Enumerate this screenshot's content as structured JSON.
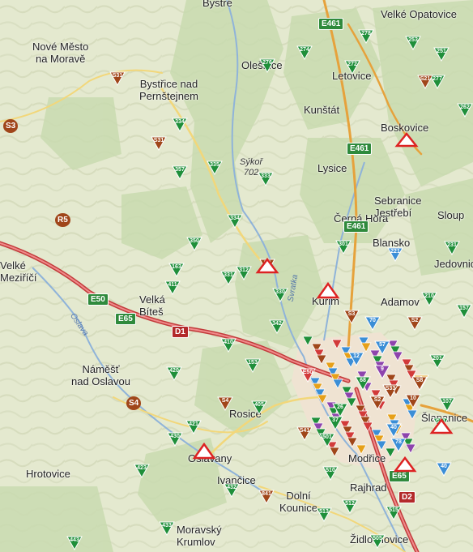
{
  "map": {
    "towns": [
      {
        "name": "Nové Město\nna Moravě",
        "key": "nove-mesto"
      },
      {
        "name": "Bystřice nad\nPernštejnem",
        "key": "bystrice"
      },
      {
        "name": "Olešnice",
        "key": "olesnice"
      },
      {
        "name": "Letovice",
        "key": "letovice"
      },
      {
        "name": "Kunštát",
        "key": "kunstat"
      },
      {
        "name": "Boskovice",
        "key": "boskovice"
      },
      {
        "name": "Velké Opatovice",
        "key": "velke-opatovice"
      },
      {
        "name": "Velké\nMeziříčí",
        "key": "velke-mezirici"
      },
      {
        "name": "Velká\nBíteš",
        "key": "velka-bites"
      },
      {
        "name": "Náměšť\nnad Oslavou",
        "key": "namest"
      },
      {
        "name": "Hrotovice",
        "key": "hrotovice"
      },
      {
        "name": "Rosice",
        "key": "rosice"
      },
      {
        "name": "Oslavany",
        "key": "oslavany"
      },
      {
        "name": "Ivančice",
        "key": "ivancice"
      },
      {
        "name": "Blansko",
        "key": "blansko"
      },
      {
        "name": "Adamov",
        "key": "adamov"
      },
      {
        "name": "Kuřim",
        "key": "kurim"
      },
      {
        "name": "Jedovnice",
        "key": "jedovnice"
      },
      {
        "name": "Sloup",
        "key": "sloup"
      },
      {
        "name": "Lysice",
        "key": "lysice"
      },
      {
        "name": "Černá Hora",
        "key": "cerna-hora"
      },
      {
        "name": "Šlapanice",
        "key": "slapanice"
      },
      {
        "name": "Modřice",
        "key": "modrice"
      },
      {
        "name": "Rajhrad",
        "key": "rajhrad"
      },
      {
        "name": "Dolní\nKounice",
        "key": "dolni-kounice"
      },
      {
        "name": "Moravský\nKrumlov",
        "key": "moravsky-krumlov"
      },
      {
        "name": "Židlochovice",
        "key": "zidlochovice"
      },
      {
        "name": "Bystré",
        "key": "bystre"
      },
      {
        "name": "Sebranice\nJestřebí",
        "key": "jestrebi"
      }
    ],
    "peak": {
      "name": "Sýkoř",
      "elevation": "702"
    },
    "rivers": [
      "Oslava",
      "Svratka"
    ],
    "road_shields": [
      {
        "label": "E50",
        "kind": "e"
      },
      {
        "label": "E65",
        "kind": "e"
      },
      {
        "label": "D1",
        "kind": "d"
      },
      {
        "label": "E461",
        "kind": "e"
      },
      {
        "label": "E461",
        "kind": "e"
      },
      {
        "label": "E461",
        "kind": "e"
      },
      {
        "label": "E65",
        "kind": "e"
      },
      {
        "label": "D2",
        "kind": "d"
      },
      {
        "label": "S3",
        "kind": "s"
      },
      {
        "label": "R5",
        "kind": "s"
      },
      {
        "label": "S4",
        "kind": "s"
      }
    ],
    "markers": [
      {
        "label": "274",
        "color": "green"
      },
      {
        "label": "276",
        "color": "green"
      },
      {
        "label": "272",
        "color": "green"
      },
      {
        "label": "278",
        "color": "green"
      },
      {
        "label": "253",
        "color": "green"
      },
      {
        "label": "251",
        "color": "green"
      },
      {
        "label": "277",
        "color": "green"
      },
      {
        "label": "S21",
        "color": "brown"
      },
      {
        "label": "S31",
        "color": "brown"
      },
      {
        "label": "334",
        "color": "green"
      },
      {
        "label": "335",
        "color": "green"
      },
      {
        "label": "S31",
        "color": "brown"
      },
      {
        "label": "357",
        "color": "green"
      },
      {
        "label": "333",
        "color": "green"
      },
      {
        "label": "334",
        "color": "green"
      },
      {
        "label": "350",
        "color": "green"
      },
      {
        "label": "163",
        "color": "green"
      },
      {
        "label": "411",
        "color": "green"
      },
      {
        "label": "312",
        "color": "green"
      },
      {
        "label": "331",
        "color": "green"
      },
      {
        "label": "S3",
        "color": "brown"
      },
      {
        "label": "330",
        "color": "green"
      },
      {
        "label": "342",
        "color": "green"
      },
      {
        "label": "410",
        "color": "green"
      },
      {
        "label": "153",
        "color": "green"
      },
      {
        "label": "420",
        "color": "green"
      },
      {
        "label": "S4",
        "color": "brown"
      },
      {
        "label": "405",
        "color": "green"
      },
      {
        "label": "421",
        "color": "green"
      },
      {
        "label": "430",
        "color": "green"
      },
      {
        "label": "423",
        "color": "green"
      },
      {
        "label": "S41",
        "color": "brown"
      },
      {
        "label": "501",
        "color": "green"
      },
      {
        "label": "70",
        "color": "blue"
      },
      {
        "label": "57",
        "color": "blue"
      },
      {
        "label": "12",
        "color": "blue"
      },
      {
        "label": "68",
        "color": "green"
      },
      {
        "label": "26",
        "color": "green"
      },
      {
        "label": "37",
        "color": "green"
      },
      {
        "label": "40",
        "color": "blue"
      },
      {
        "label": "E50",
        "color": "red"
      },
      {
        "label": "9",
        "color": "purple"
      },
      {
        "label": "S2",
        "color": "brown"
      },
      {
        "label": "S33",
        "color": "brown"
      },
      {
        "label": "10",
        "color": "brown"
      },
      {
        "label": "8",
        "color": "orange"
      },
      {
        "label": "201",
        "color": "green"
      },
      {
        "label": "210",
        "color": "green"
      },
      {
        "label": "157",
        "color": "green"
      },
      {
        "label": "231",
        "color": "green"
      },
      {
        "label": "S31",
        "color": "green"
      },
      {
        "label": "107",
        "color": "green"
      },
      {
        "label": "40",
        "color": "blue"
      },
      {
        "label": "78",
        "color": "blue"
      },
      {
        "label": "510",
        "color": "green"
      },
      {
        "label": "513",
        "color": "green"
      },
      {
        "label": "512",
        "color": "green"
      },
      {
        "label": "505",
        "color": "green"
      },
      {
        "label": "515",
        "color": "green"
      },
      {
        "label": "841",
        "color": "brown"
      },
      {
        "label": "443",
        "color": "green"
      },
      {
        "label": "433",
        "color": "green"
      },
      {
        "label": "432",
        "color": "green"
      },
      {
        "label": "S8",
        "color": "brown"
      },
      {
        "label": "221",
        "color": "blue"
      },
      {
        "label": "301",
        "color": "green"
      },
      {
        "label": "S2",
        "color": "brown"
      },
      {
        "label": "S3",
        "color": "brown"
      },
      {
        "label": "262",
        "color": "green"
      }
    ]
  }
}
